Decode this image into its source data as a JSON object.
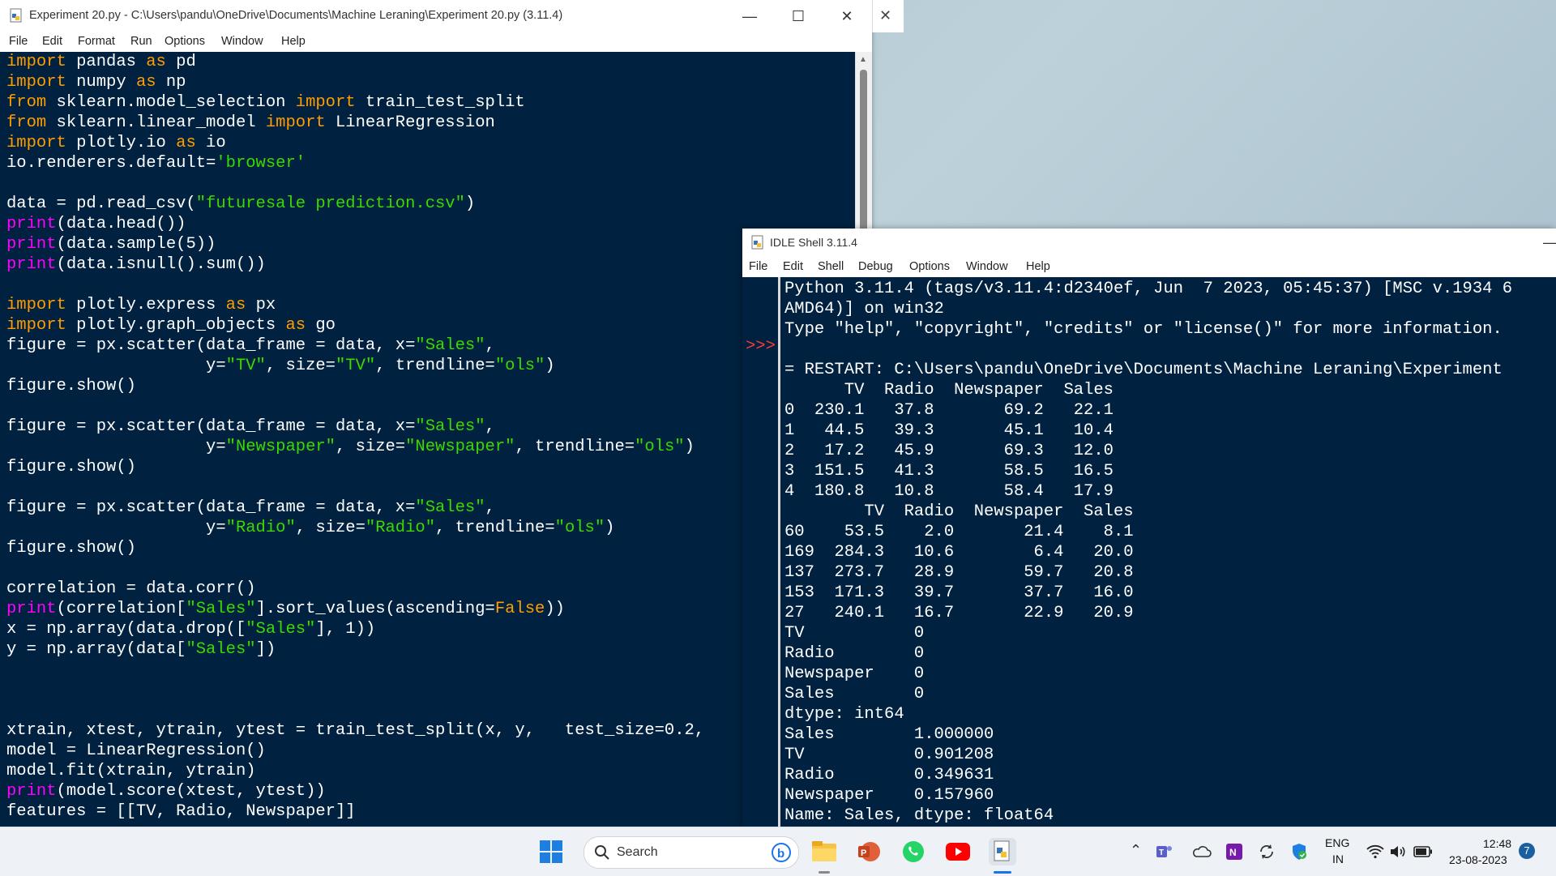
{
  "editor": {
    "title": "Experiment 20.py - C:\\Users\\pandu\\OneDrive\\Documents\\Machine Leraning\\Experiment 20.py (3.11.4)",
    "menu": [
      "File",
      "Edit",
      "Format",
      "Run",
      "Options",
      "Window",
      "Help"
    ],
    "code_lines": [
      [
        [
          "kw",
          "import"
        ],
        [
          "t",
          " pandas "
        ],
        [
          "kw",
          "as"
        ],
        [
          "t",
          " pd"
        ]
      ],
      [
        [
          "kw",
          "import"
        ],
        [
          "t",
          " numpy "
        ],
        [
          "kw",
          "as"
        ],
        [
          "t",
          " np"
        ]
      ],
      [
        [
          "kw",
          "from"
        ],
        [
          "t",
          " sklearn.model_selection "
        ],
        [
          "kw",
          "import"
        ],
        [
          "t",
          " train_test_split"
        ]
      ],
      [
        [
          "kw",
          "from"
        ],
        [
          "t",
          " sklearn.linear_model "
        ],
        [
          "kw",
          "import"
        ],
        [
          "t",
          " LinearRegression"
        ]
      ],
      [
        [
          "kw",
          "import"
        ],
        [
          "t",
          " plotly.io "
        ],
        [
          "kw",
          "as"
        ],
        [
          "t",
          " io"
        ]
      ],
      [
        [
          "t",
          "io.renderers.default="
        ],
        [
          "st",
          "'browser'"
        ]
      ],
      [],
      [
        [
          "t",
          "data = pd.read_csv("
        ],
        [
          "st",
          "\"futuresale prediction.csv\""
        ],
        [
          "t",
          ")"
        ]
      ],
      [
        [
          "bi",
          "print"
        ],
        [
          "t",
          "(data.head())"
        ]
      ],
      [
        [
          "bi",
          "print"
        ],
        [
          "t",
          "(data.sample(5))"
        ]
      ],
      [
        [
          "bi",
          "print"
        ],
        [
          "t",
          "(data.isnull().sum())"
        ]
      ],
      [],
      [
        [
          "kw",
          "import"
        ],
        [
          "t",
          " plotly.express "
        ],
        [
          "kw",
          "as"
        ],
        [
          "t",
          " px"
        ]
      ],
      [
        [
          "kw",
          "import"
        ],
        [
          "t",
          " plotly.graph_objects "
        ],
        [
          "kw",
          "as"
        ],
        [
          "t",
          " go"
        ]
      ],
      [
        [
          "t",
          "figure = px.scatter(data_frame = data, x="
        ],
        [
          "st",
          "\"Sales\""
        ],
        [
          "t",
          ","
        ]
      ],
      [
        [
          "t",
          "                    y="
        ],
        [
          "st",
          "\"TV\""
        ],
        [
          "t",
          ", size="
        ],
        [
          "st",
          "\"TV\""
        ],
        [
          "t",
          ", trendline="
        ],
        [
          "st",
          "\"ols\""
        ],
        [
          "t",
          ")"
        ]
      ],
      [
        [
          "t",
          "figure.show()"
        ]
      ],
      [],
      [
        [
          "t",
          "figure = px.scatter(data_frame = data, x="
        ],
        [
          "st",
          "\"Sales\""
        ],
        [
          "t",
          ","
        ]
      ],
      [
        [
          "t",
          "                    y="
        ],
        [
          "st",
          "\"Newspaper\""
        ],
        [
          "t",
          ", size="
        ],
        [
          "st",
          "\"Newspaper\""
        ],
        [
          "t",
          ", trendline="
        ],
        [
          "st",
          "\"ols\""
        ],
        [
          "t",
          ")"
        ]
      ],
      [
        [
          "t",
          "figure.show()"
        ]
      ],
      [],
      [
        [
          "t",
          "figure = px.scatter(data_frame = data, x="
        ],
        [
          "st",
          "\"Sales\""
        ],
        [
          "t",
          ","
        ]
      ],
      [
        [
          "t",
          "                    y="
        ],
        [
          "st",
          "\"Radio\""
        ],
        [
          "t",
          ", size="
        ],
        [
          "st",
          "\"Radio\""
        ],
        [
          "t",
          ", trendline="
        ],
        [
          "st",
          "\"ols\""
        ],
        [
          "t",
          ")"
        ]
      ],
      [
        [
          "t",
          "figure.show()"
        ]
      ],
      [],
      [
        [
          "t",
          "correlation = data.corr()"
        ]
      ],
      [
        [
          "bi",
          "print"
        ],
        [
          "t",
          "(correlation["
        ],
        [
          "st",
          "\"Sales\""
        ],
        [
          "t",
          "].sort_values(ascending="
        ],
        [
          "kw",
          "False"
        ],
        [
          "t",
          "))"
        ]
      ],
      [
        [
          "t",
          "x = np.array(data.drop(["
        ],
        [
          "st",
          "\"Sales\""
        ],
        [
          "t",
          "], 1))"
        ]
      ],
      [
        [
          "t",
          "y = np.array(data["
        ],
        [
          "st",
          "\"Sales\""
        ],
        [
          "t",
          "])"
        ]
      ],
      [],
      [],
      [],
      [
        [
          "t",
          "xtrain, xtest, ytrain, ytest = train_test_split(x, y,   test_size=0.2,"
        ]
      ],
      [
        [
          "t",
          "model = LinearRegression()"
        ]
      ],
      [
        [
          "t",
          "model.fit(xtrain, ytrain)"
        ]
      ],
      [
        [
          "bi",
          "print"
        ],
        [
          "t",
          "(model.score(xtest, ytest))"
        ]
      ],
      [
        [
          "t",
          "features = [[TV, Radio, Newspaper]]"
        ]
      ]
    ]
  },
  "shell": {
    "title": "IDLE Shell 3.11.4",
    "menu": [
      "File",
      "Edit",
      "Shell",
      "Debug",
      "Options",
      "Window",
      "Help"
    ],
    "prompt": ">>>",
    "lines": [
      "Python 3.11.4 (tags/v3.11.4:d2340ef, Jun  7 2023, 05:45:37) [MSC v.1934 6",
      "AMD64)] on win32",
      "Type \"help\", \"copyright\", \"credits\" or \"license()\" for more information.",
      "",
      "= RESTART: C:\\Users\\pandu\\OneDrive\\Documents\\Machine Leraning\\Experiment",
      "      TV  Radio  Newspaper  Sales",
      "0  230.1   37.8       69.2   22.1",
      "1   44.5   39.3       45.1   10.4",
      "2   17.2   45.9       69.3   12.0",
      "3  151.5   41.3       58.5   16.5",
      "4  180.8   10.8       58.4   17.9",
      "        TV  Radio  Newspaper  Sales",
      "60    53.5    2.0       21.4    8.1",
      "169  284.3   10.6        6.4   20.0",
      "137  273.7   28.9       59.7   20.8",
      "153  171.3   39.7       37.7   16.0",
      "27   240.1   16.7       22.9   20.9",
      "TV           0",
      "Radio        0",
      "Newspaper    0",
      "Sales        0",
      "dtype: int64",
      "Sales        1.000000",
      "TV           0.901208",
      "Radio        0.349631",
      "Newspaper    0.157960",
      "Name: Sales, dtype: float64"
    ]
  },
  "taskbar": {
    "search_label": "Search",
    "lang_top": "ENG",
    "lang_bottom": "IN",
    "time": "12:48",
    "date": "23-08-2023",
    "notification_count": "7"
  },
  "colors": {
    "code_bg": "#002240",
    "keyword": "#ff9d00",
    "string": "#3ad900",
    "builtin": "#ff00ff",
    "prompt": "#ff3b3b"
  }
}
